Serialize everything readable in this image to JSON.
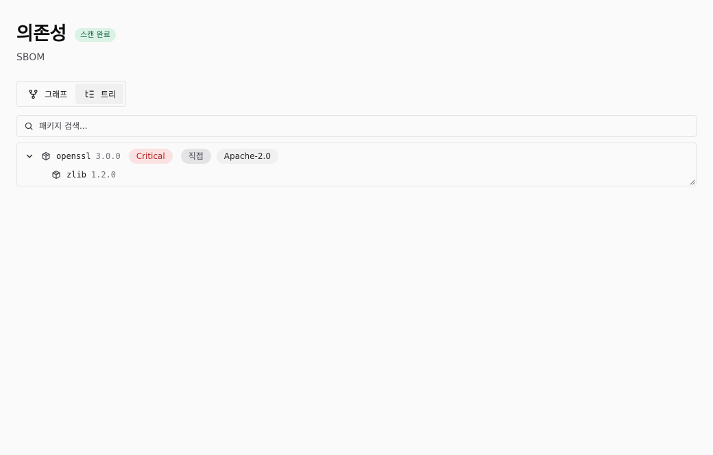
{
  "header": {
    "title": "의존성",
    "status_badge": "스캔 완료",
    "subtitle": "SBOM"
  },
  "view_toggle": {
    "graph_label": "그래프",
    "graph_icon": "git-fork-icon",
    "tree_label": "트리",
    "tree_icon": "list-tree-icon",
    "selected": "트리"
  },
  "search": {
    "placeholder": "패키지 검색...",
    "value": "",
    "icon": "search-icon"
  },
  "tree": {
    "root": {
      "name": "openssl",
      "version": "3.0.0",
      "severity": "Critical",
      "relation": "직접",
      "license": "Apache-2.0",
      "expanded": true,
      "icon": "package-icon"
    },
    "children": [
      {
        "name": "zlib",
        "version": "1.2.0",
        "icon": "package-icon"
      }
    ]
  },
  "colors": {
    "background": "#fafafa",
    "status_badge_bg": "#dcf2e6",
    "status_badge_text": "#15694a",
    "critical_bg": "#fbe2e2",
    "critical_text": "#b91c1c",
    "border": "#e4e4e7"
  }
}
